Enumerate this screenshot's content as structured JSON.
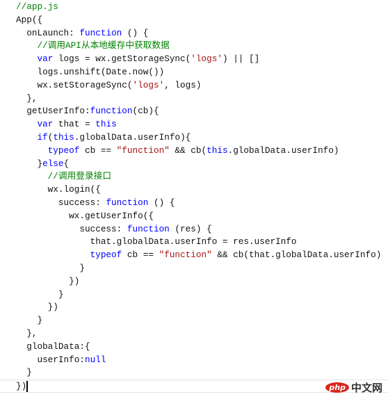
{
  "colors": {
    "keyword": "#0000ff",
    "comment": "#008000",
    "string": "#a31515",
    "text": "#111111"
  },
  "code": {
    "lines": [
      [
        [
          "//app.js",
          "c"
        ]
      ],
      [
        [
          "App({",
          "p"
        ]
      ],
      [
        [
          "  onLaunch: ",
          "p"
        ],
        [
          "function",
          "k"
        ],
        [
          " () {",
          "p"
        ]
      ],
      [
        [
          "    //调用API从本地缓存中获取数据",
          "c"
        ]
      ],
      [
        [
          "    ",
          "p"
        ],
        [
          "var",
          "k"
        ],
        [
          " logs = wx.getStorageSync(",
          "p"
        ],
        [
          "'logs'",
          "s"
        ],
        [
          ") || []",
          "p"
        ]
      ],
      [
        [
          "    logs.unshift(Date.now())",
          "p"
        ]
      ],
      [
        [
          "    wx.setStorageSync(",
          "p"
        ],
        [
          "'logs'",
          "s"
        ],
        [
          ", logs)",
          "p"
        ]
      ],
      [
        [
          "  },",
          "p"
        ]
      ],
      [
        [
          "  getUserInfo:",
          "p"
        ],
        [
          "function",
          "k"
        ],
        [
          "(cb){",
          "p"
        ]
      ],
      [
        [
          "    ",
          "p"
        ],
        [
          "var",
          "k"
        ],
        [
          " that = ",
          "p"
        ],
        [
          "this",
          "k"
        ]
      ],
      [
        [
          "    ",
          "p"
        ],
        [
          "if",
          "k"
        ],
        [
          "(",
          "p"
        ],
        [
          "this",
          "k"
        ],
        [
          ".globalData.userInfo){",
          "p"
        ]
      ],
      [
        [
          "      ",
          "p"
        ],
        [
          "typeof",
          "k"
        ],
        [
          " cb == ",
          "p"
        ],
        [
          "\"function\"",
          "s"
        ],
        [
          " && cb(",
          "p"
        ],
        [
          "this",
          "k"
        ],
        [
          ".globalData.userInfo)",
          "p"
        ]
      ],
      [
        [
          "    }",
          "p"
        ],
        [
          "else",
          "k"
        ],
        [
          "{",
          "p"
        ]
      ],
      [
        [
          "      //调用登录接口",
          "c"
        ]
      ],
      [
        [
          "      wx.login({",
          "p"
        ]
      ],
      [
        [
          "        success: ",
          "p"
        ],
        [
          "function",
          "k"
        ],
        [
          " () {",
          "p"
        ]
      ],
      [
        [
          "          wx.getUserInfo({",
          "p"
        ]
      ],
      [
        [
          "            success: ",
          "p"
        ],
        [
          "function",
          "k"
        ],
        [
          " (res) {",
          "p"
        ]
      ],
      [
        [
          "              that.globalData.userInfo = res.userInfo",
          "p"
        ]
      ],
      [
        [
          "              ",
          "p"
        ],
        [
          "typeof",
          "k"
        ],
        [
          " cb == ",
          "p"
        ],
        [
          "\"function\"",
          "s"
        ],
        [
          " && cb(that.globalData.userInfo)",
          "p"
        ]
      ],
      [
        [
          "            }",
          "p"
        ]
      ],
      [
        [
          "          })",
          "p"
        ]
      ],
      [
        [
          "        }",
          "p"
        ]
      ],
      [
        [
          "      })",
          "p"
        ]
      ],
      [
        [
          "    }",
          "p"
        ]
      ],
      [
        [
          "  },",
          "p"
        ]
      ],
      [
        [
          "  globalData:{",
          "p"
        ]
      ],
      [
        [
          "    userInfo:",
          "p"
        ],
        [
          "null",
          "k"
        ]
      ],
      [
        [
          "  }",
          "p"
        ]
      ],
      [
        [
          "})",
          "p"
        ]
      ]
    ],
    "current_line": 30
  },
  "watermark": {
    "brand": "php",
    "site": "中文网"
  }
}
